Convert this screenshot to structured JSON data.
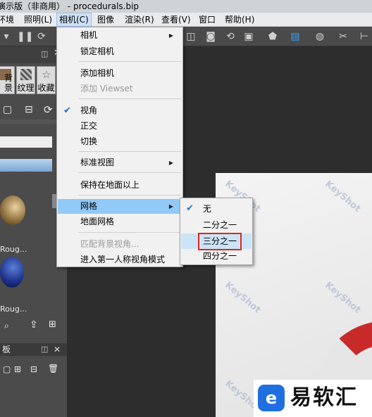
{
  "window": {
    "title": "注册演示版（非商用） - procedurals.bip"
  },
  "menubar": {
    "items": [
      {
        "label": "环境"
      },
      {
        "label": "照明(L)"
      },
      {
        "label": "相机(C)"
      },
      {
        "label": "图像"
      },
      {
        "label": "渲染(R)"
      },
      {
        "label": "查看(V)"
      },
      {
        "label": "窗口"
      },
      {
        "label": "帮助(H)"
      }
    ]
  },
  "library": {
    "tabs": [
      {
        "label": "背景",
        "icon": "background-icon"
      },
      {
        "label": "纹理",
        "icon": "texture-icon"
      },
      {
        "label": "收藏",
        "icon": "favorite-star-icon"
      }
    ],
    "thumbnails": [
      {
        "label": "Roug..."
      },
      {
        "label": "Roug..."
      }
    ]
  },
  "bottom_panel": {
    "title": "板"
  },
  "camera_menu": {
    "items": [
      {
        "label": "相机",
        "submenu": true
      },
      {
        "label": "锁定相机"
      },
      {
        "label": "添加相机"
      },
      {
        "label": "添加 Viewset",
        "disabled": true
      },
      {
        "label": "视角",
        "checked": true
      },
      {
        "label": "正交"
      },
      {
        "label": "切换"
      },
      {
        "label": "标准视图",
        "submenu": true
      },
      {
        "label": "保持在地面以上"
      },
      {
        "label": "网格",
        "submenu": true,
        "highlighted": true
      },
      {
        "label": "地面网格"
      },
      {
        "label": "匹配背景视角...",
        "disabled": true
      },
      {
        "label": "进入第一人称视角模式"
      }
    ]
  },
  "grid_submenu": {
    "items": [
      {
        "label": "无",
        "checked": true
      },
      {
        "label": "二分之一"
      },
      {
        "label": "三分之一",
        "highlighted": true
      },
      {
        "label": "四分之一"
      }
    ]
  },
  "render": {
    "watermark": "KeyShot"
  },
  "logo": {
    "text": "易软汇"
  },
  "colors": {
    "menu_highlight": "#91c9f7",
    "annotation_red": "#e0261c",
    "logo_blue": "#1f6fe0"
  }
}
